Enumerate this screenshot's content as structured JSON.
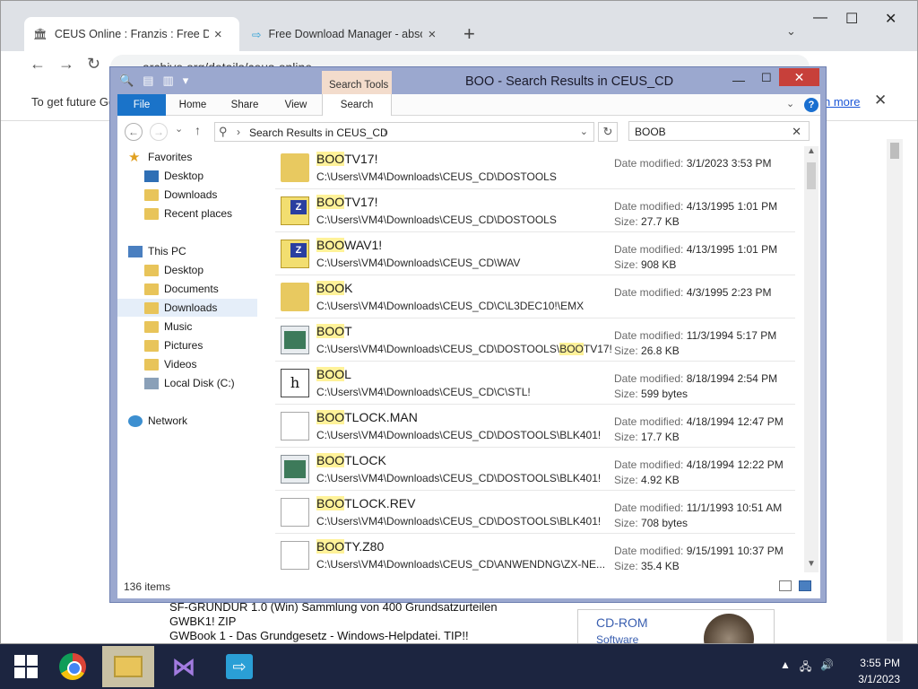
{
  "browser": {
    "tabs": [
      {
        "title": "CEUS Online : Franzis : Free Dow",
        "close": "×"
      },
      {
        "title": "Free Download Manager - absolu",
        "close": "×"
      }
    ],
    "new_tab": "+",
    "tab_search": "⌄",
    "window_controls": {
      "minimize": "—",
      "maximize": "☐",
      "close": "✕"
    },
    "nav": {
      "back": "←",
      "forward": "→",
      "reload": "↻"
    },
    "url": "archive.org/details/ceus-online",
    "infobar_text": "To get future Go",
    "infobar_link": "n more",
    "infobar_close": "✕",
    "page_lines": [
      "SF-GRUNDUR 1.0 (Win) Sammlung von 400 Grundsatzurteilen",
      "GWBK1! ZIP",
      "GWBook 1 - Das Grundgesetz - Windows-Helpdatei. TIP!!"
    ],
    "side_box": {
      "title": "CD-ROM",
      "subtitle": "Software"
    }
  },
  "explorer": {
    "title": "BOO - Search Results in CEUS_CD",
    "contextual_tab": "Search Tools",
    "ribbon_tabs": [
      "File",
      "Home",
      "Share",
      "View",
      "Search"
    ],
    "ribbon_collapse": "⌄",
    "help": "?",
    "window_controls": {
      "minimize": "—",
      "maximize": "☐",
      "close": "✕"
    },
    "nav_buttons": {
      "back": "←",
      "forward": "→",
      "recent": "⌄",
      "up": "↑"
    },
    "address": "Search Results in CEUS_CD",
    "address_sep": "›",
    "address_dropdown": "⌄",
    "refresh": "↻",
    "search_value": "BOOB",
    "search_clear": "✕",
    "nav_pane": [
      {
        "label": "Favorites",
        "icon": "star-icon"
      },
      {
        "label": "Desktop",
        "icon": "desktop-icon"
      },
      {
        "label": "Downloads",
        "icon": "folder-icon"
      },
      {
        "label": "Recent places",
        "icon": "folder-icon"
      },
      {
        "label": "This PC",
        "icon": "computer-icon"
      },
      {
        "label": "Desktop",
        "icon": "desktop-icon"
      },
      {
        "label": "Documents",
        "icon": "folder-icon"
      },
      {
        "label": "Downloads",
        "icon": "folder-icon",
        "selected": true
      },
      {
        "label": "Music",
        "icon": "folder-icon"
      },
      {
        "label": "Pictures",
        "icon": "folder-icon"
      },
      {
        "label": "Videos",
        "icon": "folder-icon"
      },
      {
        "label": "Local Disk (C:)",
        "icon": "disk-icon"
      },
      {
        "label": "Network",
        "icon": "network-icon"
      }
    ],
    "results": [
      {
        "hl": "BOO",
        "rest": "TV17!",
        "path_pre": "C:\\Users\\VM4\\Downloads\\CEUS_CD\\DOSTOOLS",
        "path_hl": "",
        "path_post": "",
        "icon": "folder-icon",
        "date_label": "Date modified: ",
        "date": "3/1/2023 3:53 PM",
        "size_label": "",
        "size": ""
      },
      {
        "hl": "BOO",
        "rest": "TV17!",
        "path_pre": "C:\\Users\\VM4\\Downloads\\CEUS_CD\\DOSTOOLS",
        "path_hl": "",
        "path_post": "",
        "icon": "zip-icon",
        "date_label": "Date modified: ",
        "date": "4/13/1995 1:01 PM",
        "size_label": "Size: ",
        "size": "27.7 KB"
      },
      {
        "hl": "BOO",
        "rest": "WAV1!",
        "path_pre": "C:\\Users\\VM4\\Downloads\\CEUS_CD\\WAV",
        "path_hl": "",
        "path_post": "",
        "icon": "zip-icon",
        "date_label": "Date modified: ",
        "date": "4/13/1995 1:01 PM",
        "size_label": "Size: ",
        "size": "908 KB"
      },
      {
        "hl": "BOO",
        "rest": "K",
        "path_pre": "C:\\Users\\VM4\\Downloads\\CEUS_CD\\C\\L3DEC10!\\EMX",
        "path_hl": "",
        "path_post": "",
        "icon": "folder-icon",
        "date_label": "Date modified: ",
        "date": "4/3/1995 2:23 PM",
        "size_label": "",
        "size": ""
      },
      {
        "hl": "BOO",
        "rest": "T",
        "path_pre": "C:\\Users\\VM4\\Downloads\\CEUS_CD\\DOSTOOLS\\",
        "path_hl": "BOO",
        "path_post": "TV17!",
        "icon": "application-icon",
        "date_label": "Date modified: ",
        "date": "11/3/1994 5:17 PM",
        "size_label": "Size: ",
        "size": "26.8 KB"
      },
      {
        "hl": "BOO",
        "rest": "L",
        "path_pre": "C:\\Users\\VM4\\Downloads\\CEUS_CD\\C\\STL!",
        "path_hl": "",
        "path_post": "",
        "icon": "header-file-icon",
        "date_label": "Date modified: ",
        "date": "8/18/1994 2:54 PM",
        "size_label": "Size: ",
        "size": "599 bytes"
      },
      {
        "hl": "BOO",
        "rest": "TLOCK.MAN",
        "path_pre": "C:\\Users\\VM4\\Downloads\\CEUS_CD\\DOSTOOLS\\BLK401!",
        "path_hl": "",
        "path_post": "",
        "icon": "document-icon",
        "date_label": "Date modified: ",
        "date": "4/18/1994 12:47 PM",
        "size_label": "Size: ",
        "size": "17.7 KB"
      },
      {
        "hl": "BOO",
        "rest": "TLOCK",
        "path_pre": "C:\\Users\\VM4\\Downloads\\CEUS_CD\\DOSTOOLS\\BLK401!",
        "path_hl": "",
        "path_post": "",
        "icon": "application-icon",
        "date_label": "Date modified: ",
        "date": "4/18/1994 12:22 PM",
        "size_label": "Size: ",
        "size": "4.92 KB"
      },
      {
        "hl": "BOO",
        "rest": "TLOCK.REV",
        "path_pre": "C:\\Users\\VM4\\Downloads\\CEUS_CD\\DOSTOOLS\\BLK401!",
        "path_hl": "",
        "path_post": "",
        "icon": "document-icon",
        "date_label": "Date modified: ",
        "date": "11/1/1993 10:51 AM",
        "size_label": "Size: ",
        "size": "708 bytes"
      },
      {
        "hl": "BOO",
        "rest": "TY.Z80",
        "path_pre": "C:\\Users\\VM4\\Downloads\\CEUS_CD\\ANWENDNG\\ZX-NE...",
        "path_hl": "",
        "path_post": "",
        "icon": "document-icon",
        "date_label": "Date modified: ",
        "date": "9/15/1991 10:37 PM",
        "size_label": "Size: ",
        "size": "35.4 KB"
      }
    ],
    "item_count": "136 items",
    "scroll_up": "▲",
    "scroll_down": "▼"
  },
  "taskbar": {
    "clock_time": "3:55 PM",
    "clock_date": "3/1/2023",
    "tray": {
      "chevron": "▲",
      "network": "🖧",
      "volume": "🔊"
    },
    "vs_glyph": "⋈",
    "fdm_glyph": "⇨"
  }
}
